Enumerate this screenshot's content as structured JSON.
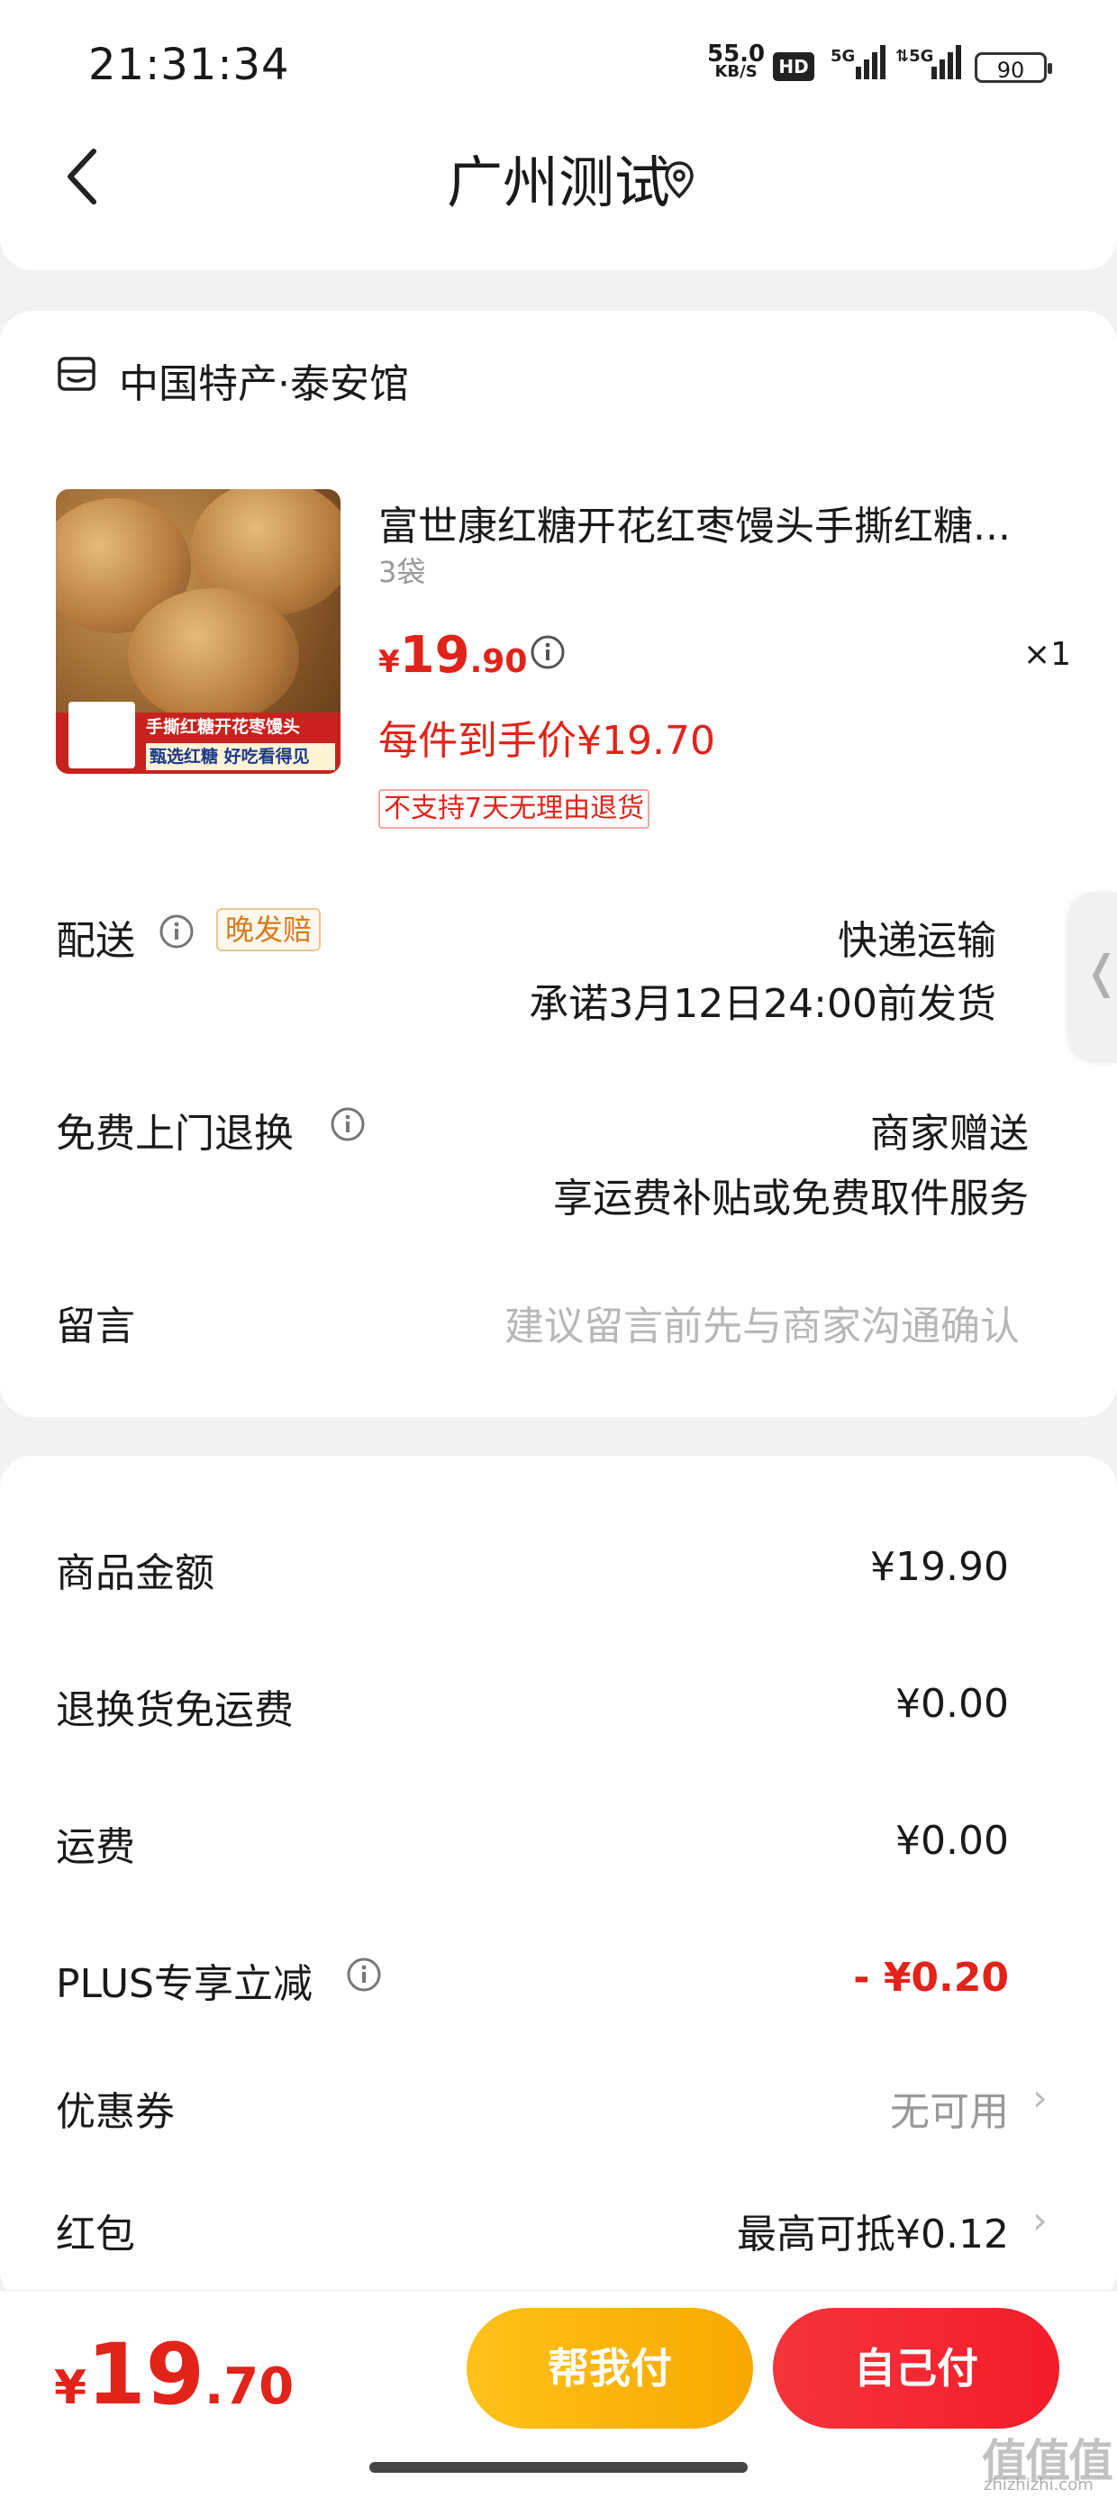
{
  "status_bar": {
    "time": "21:31:34",
    "net_speed": "55.0",
    "net_unit": "KB/S",
    "hd": "HD",
    "battery": "90"
  },
  "header": {
    "title": "广州测试"
  },
  "store": {
    "name": "中国特产·泰安馆"
  },
  "product": {
    "title": "富世康红糖开花红枣馒头手撕红糖...",
    "spec": "3袋",
    "price_symbol": "¥",
    "price_int": "19",
    "price_dec": ".90",
    "quantity": "×1",
    "each_price": "每件到手价¥19.70",
    "return_tag": "不支持7天无理由退货",
    "image_banner_top": "手撕红糖开花枣馒头",
    "image_banner_bottom": "甄选红糖 好吃看得见"
  },
  "delivery": {
    "label": "配送",
    "badge": "晚发赔",
    "method": "快递运输",
    "promise": "承诺3月12日24:00前发货"
  },
  "return_service": {
    "label": "免费上门退换",
    "value": "商家赠送",
    "desc": "享运费补贴或免费取件服务"
  },
  "message": {
    "label": "留言",
    "placeholder": "建议留言前先与商家沟通确认"
  },
  "summary": {
    "rows": [
      {
        "label": "商品金额",
        "value": "¥19.90"
      },
      {
        "label": "退换货免运费",
        "value": "¥0.00"
      },
      {
        "label": "运费",
        "value": "¥0.00"
      },
      {
        "label": "PLUS专享立减",
        "value": "- ¥0.20"
      },
      {
        "label": "优惠券",
        "value": "无可用"
      },
      {
        "label": "红包",
        "value": "最高可抵¥0.12"
      }
    ]
  },
  "bottom": {
    "total_symbol": "¥",
    "total_int": "19",
    "total_dec": ".70",
    "help_pay": "帮我付",
    "self_pay": "自己付"
  },
  "watermark": {
    "mark": "值值值",
    "site": "zhizhizhi.com"
  },
  "colors": {
    "accent_red": "#e2231a",
    "help_button": "#f7a800",
    "self_button": "#f21c2a"
  },
  "icons": [
    "back-arrow-icon",
    "location-pin-icon",
    "store-icon",
    "info-icon",
    "chevron-right-icon",
    "side-handle-chevron-icon"
  ]
}
